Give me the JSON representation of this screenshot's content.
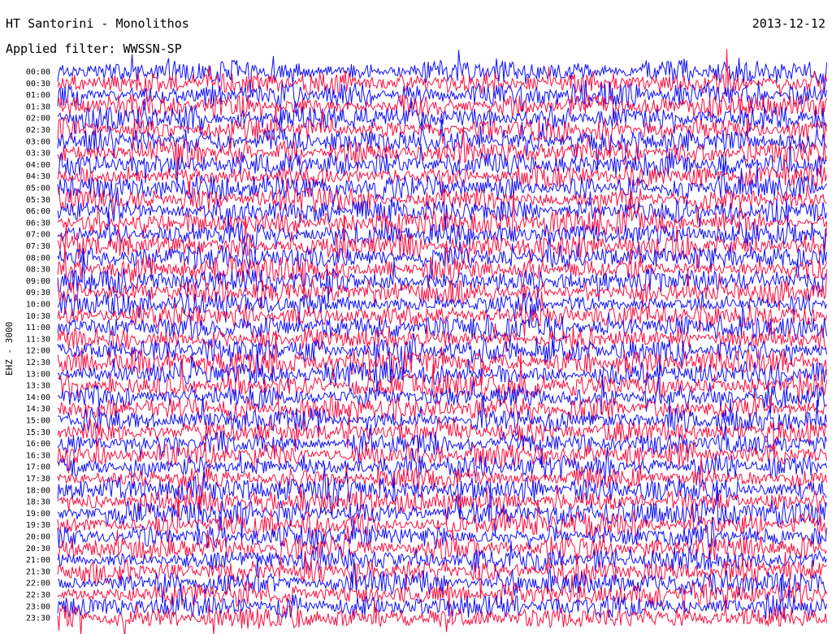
{
  "header": {
    "title": "HT Santorini - Monolithos",
    "date": "2013-12-12",
    "filter": "Applied filter: WWSSN-SP",
    "channel": "EHZ - 3000"
  },
  "colors": {
    "trace_a": "#1010f5",
    "trace_b": "#f51040",
    "background": "#ffffff",
    "text": "#000000"
  },
  "chart_data": {
    "type": "line",
    "title": "HT Santorini - Monolithos",
    "subtitle": "Applied filter: WWSSN-SP",
    "date": "2013-12-12",
    "ylabel": "EHZ - 3000",
    "xlabel": "",
    "grid": false,
    "legend": "none",
    "rows": [
      "00:00",
      "00:30",
      "01:00",
      "01:30",
      "02:00",
      "02:30",
      "03:00",
      "03:30",
      "04:00",
      "04:30",
      "05:00",
      "05:30",
      "06:00",
      "06:30",
      "07:00",
      "07:30",
      "08:00",
      "08:30",
      "09:00",
      "09:30",
      "10:00",
      "10:30",
      "11:00",
      "11:30",
      "12:00",
      "12:30",
      "13:00",
      "13:30",
      "14:00",
      "14:30",
      "15:00",
      "15:30",
      "16:00",
      "16:30",
      "17:00",
      "17:30",
      "18:00",
      "18:30",
      "19:00",
      "19:30",
      "20:00",
      "20:30",
      "21:00",
      "21:30",
      "22:00",
      "22:30",
      "23:00",
      "23:30"
    ],
    "series": [
      {
        "color": "#1010f5"
      },
      {
        "color": "#f51040"
      }
    ]
  }
}
